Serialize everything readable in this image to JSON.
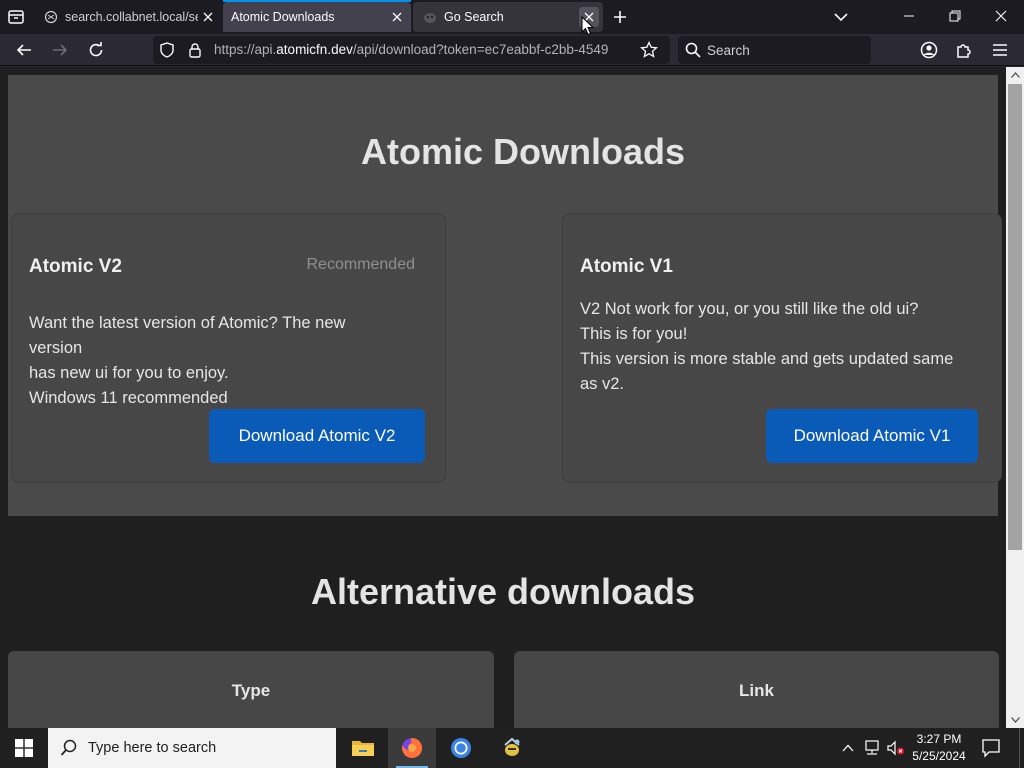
{
  "browser": {
    "tabs": [
      {
        "title": "search.collabnet.local/sea",
        "favicon": "generic-page-icon"
      },
      {
        "title": "Atomic Downloads",
        "favicon": "none"
      },
      {
        "title": "Go Search",
        "favicon": "go-gopher-icon"
      }
    ],
    "active_tab": 1,
    "url_prefix": "https://api.",
    "url_domain": "atomicfn.dev",
    "url_suffix": "/api/download?token=ec7eabbf-c2bb-4549",
    "search_placeholder": "Search"
  },
  "page": {
    "title": "Atomic Downloads",
    "cards": [
      {
        "title": "Atomic V2",
        "badge": "Recommended",
        "desc_lines": [
          "Want the latest version of Atomic? The new version",
          "has new ui for you to enjoy.",
          "Windows 11 recommended"
        ],
        "button": "Download Atomic V2"
      },
      {
        "title": "Atomic V1",
        "badge": "",
        "desc_lines": [
          "V2 Not work for you, or you still like the old ui?",
          "This is for you!",
          "This version is more stable and gets updated same as v2."
        ],
        "button": "Download Atomic V1"
      }
    ],
    "alt_title": "Alternative downloads",
    "alt_columns": [
      "Type",
      "Link"
    ]
  },
  "taskbar": {
    "search_placeholder": "Type here to search",
    "apps": [
      "file-explorer-icon",
      "firefox-icon",
      "chrome-icon",
      "app-icon"
    ],
    "time": "3:27 PM",
    "date": "5/25/2024"
  },
  "colors": {
    "accent_tab": "#0090ed",
    "download_button": "#0a5ab8",
    "hero_bg": "#4a4a4a"
  }
}
